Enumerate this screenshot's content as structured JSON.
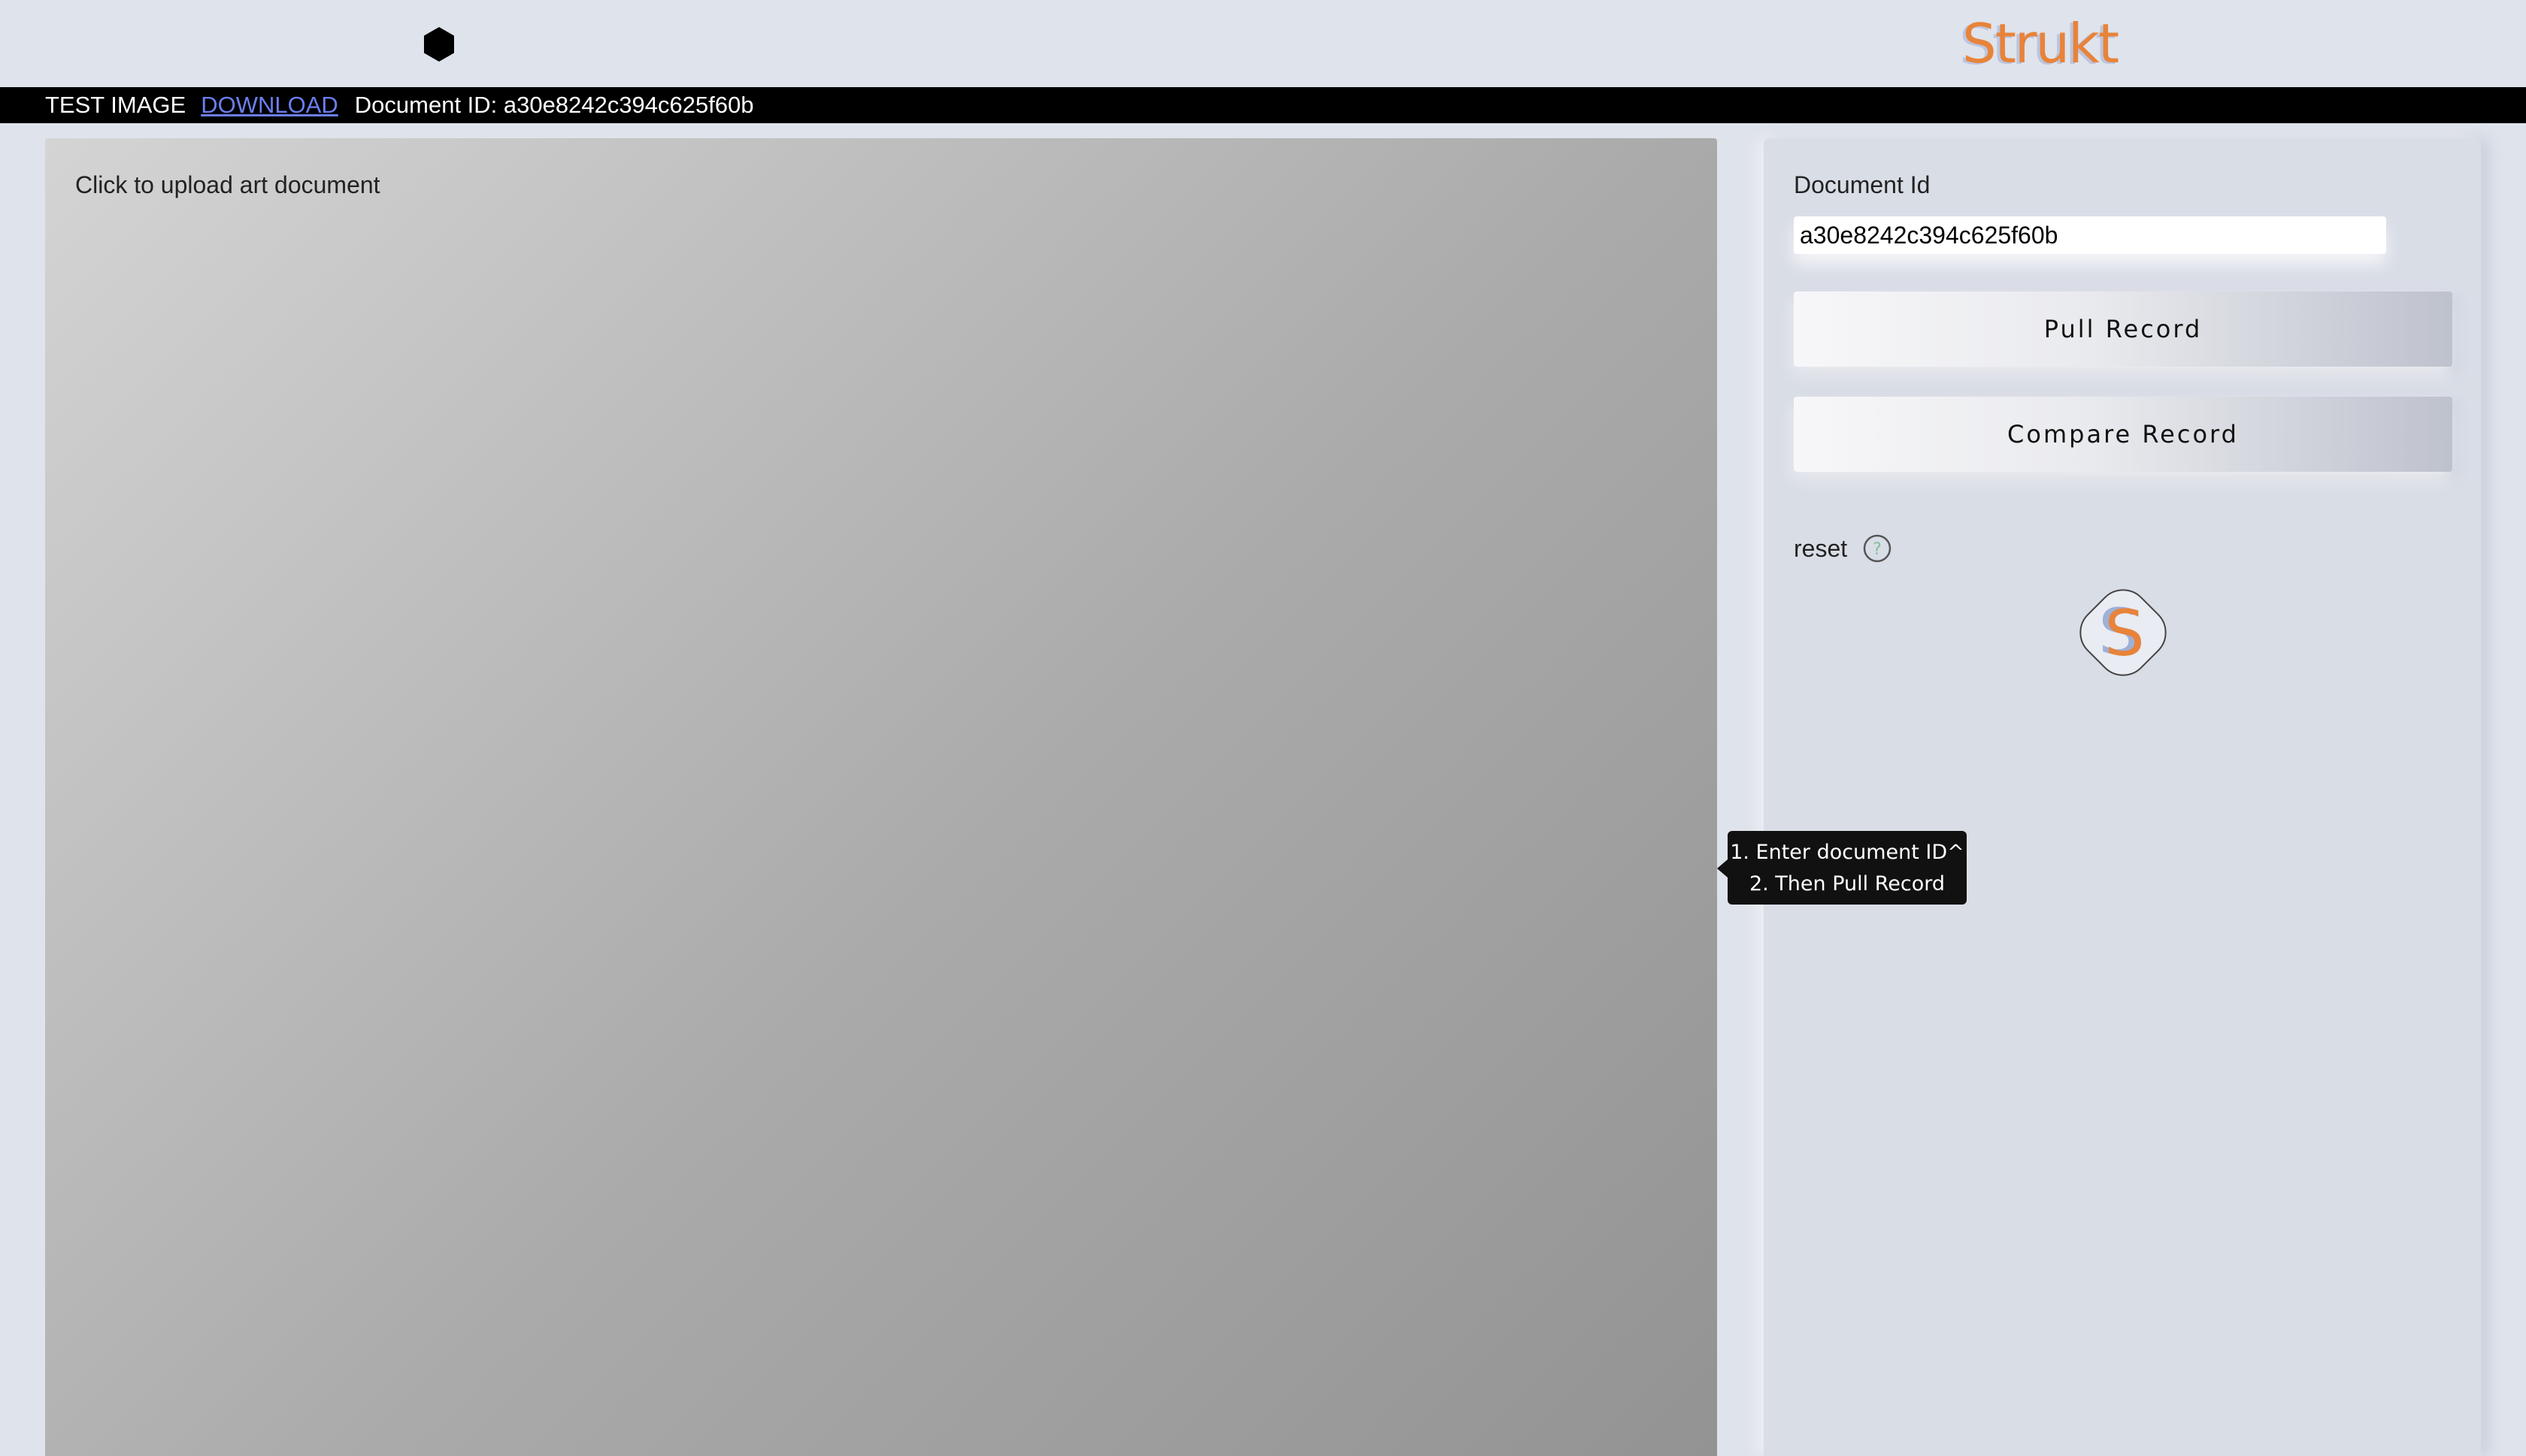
{
  "header": {
    "brand_name": "Strukt",
    "brand_color": "#e8833a",
    "icon_left": "hexagon-icon"
  },
  "infobar": {
    "test_label": "TEST IMAGE",
    "download_label": "DOWNLOAD",
    "document_id_text": "Document ID: a30e8242c394c625f60b"
  },
  "upload": {
    "prompt": "Click to upload art document"
  },
  "side_panel": {
    "document_id_label": "Document Id",
    "document_id_value": "a30e8242c394c625f60b",
    "pull_record_label": "Pull Record",
    "compare_record_label": "Compare Record",
    "reset_label": "reset",
    "help_icon": "question-circle-icon",
    "logo_letter": "S"
  },
  "tooltip": {
    "line1": "1. Enter document ID^",
    "line2": "2. Then Pull Record"
  },
  "colors": {
    "background": "#dfe3eb",
    "infobar": "#000000",
    "link": "#6b7ff0",
    "accent": "#e8833a"
  }
}
